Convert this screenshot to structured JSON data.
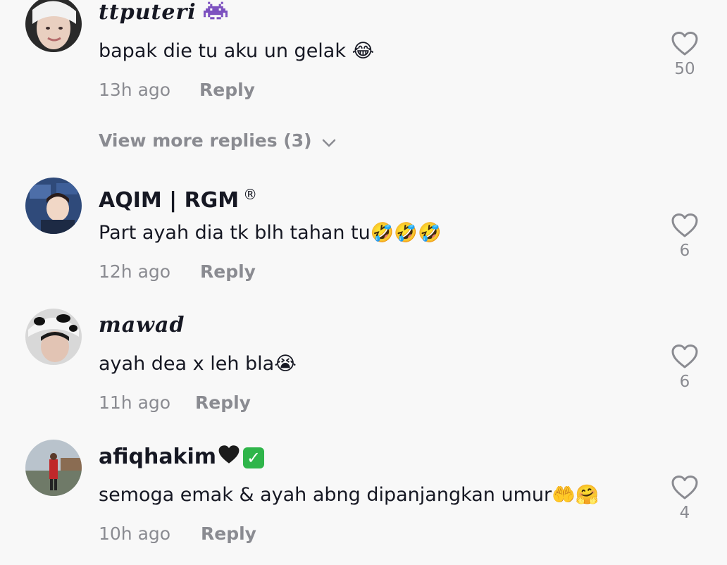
{
  "comments": [
    {
      "username": "ttputeri",
      "username_suffix_icon": "alien-monster-icon",
      "text": "bapak die tu aku un gelak 😂",
      "time": "13h ago",
      "reply_label": "Reply",
      "likes": "50"
    },
    {
      "username": "AQIM | RGM",
      "username_suffix": "®",
      "text": "Part ayah dia tk blh tahan tu🤣🤣🤣",
      "time": "12h ago",
      "reply_label": "Reply",
      "likes": "6"
    },
    {
      "username": "mawad",
      "text": "ayah dea x leh bla😭",
      "time": "11h ago",
      "reply_label": "Reply",
      "likes": "6"
    },
    {
      "username": "afiqhakim",
      "username_suffix_icons": [
        "black-heart-icon",
        "check-mark-button-icon"
      ],
      "text": "semoga emak & ayah abng dipanjangkan umur🤲🤗",
      "time": "10h ago",
      "reply_label": "Reply",
      "likes": "4"
    }
  ],
  "view_more_replies": "View more replies (3)",
  "colors": {
    "background": "#f8f8f8",
    "primary_text": "#161823",
    "secondary_text": "#8a8b91",
    "badge_green": "#2fb54a"
  }
}
